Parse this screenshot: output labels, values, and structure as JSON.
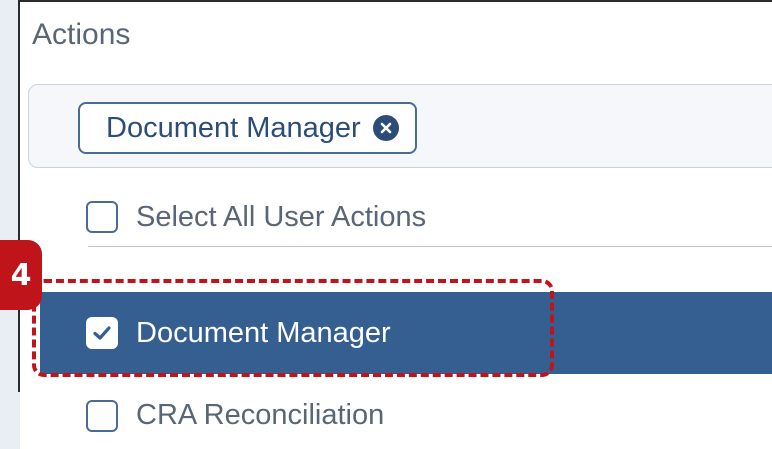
{
  "actions": {
    "label": "Actions",
    "selected_chip": {
      "label": "Document Manager",
      "remove_icon": "close-circle-icon"
    },
    "options": [
      {
        "label": "Select All User Actions",
        "checked": false
      },
      {
        "label": "Document Manager",
        "checked": true
      },
      {
        "label": "CRA Reconciliation",
        "checked": false
      }
    ]
  },
  "annotation": {
    "step_number": "4"
  },
  "colors": {
    "accent": "#365f91",
    "chip_text": "#2c4d78",
    "highlight": "#c0141b",
    "muted_text": "#5a6675"
  }
}
